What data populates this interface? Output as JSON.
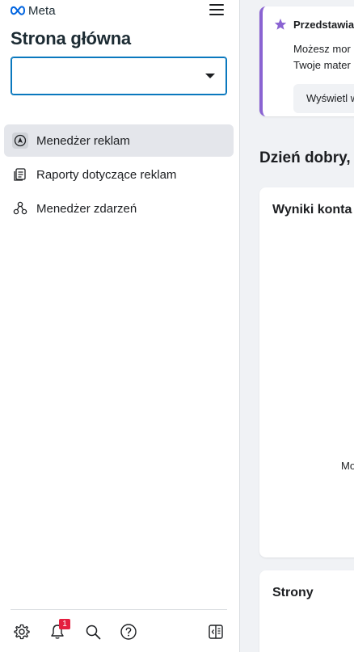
{
  "brand": {
    "name": "Meta"
  },
  "sidebar": {
    "title": "Strona główna",
    "account_select": {
      "value": ""
    },
    "items": [
      {
        "label": "Menedżer reklam",
        "icon": "ads-manager-icon",
        "active": true
      },
      {
        "label": "Raporty dotyczące reklam",
        "icon": "reports-icon",
        "active": false
      },
      {
        "label": "Menedżer zdarzeń",
        "icon": "events-manager-icon",
        "active": false
      }
    ],
    "bottom_icons": [
      "gear-icon",
      "bell-icon",
      "search-icon",
      "help-icon",
      "panel-toggle-icon"
    ],
    "notifications_count": "1"
  },
  "main": {
    "promo": {
      "title": "Przedstawia",
      "line1": "Możesz mor",
      "line2": "Twoje mater",
      "button": "Wyświetl w"
    },
    "greeting": "Dzień dobry,",
    "results_card": {
      "title": "Wyniki konta",
      "center_text": "Mo"
    },
    "pages_card": {
      "title": "Strony"
    }
  },
  "colors": {
    "accent": "#0a78be",
    "promo_border": "#8a63d2",
    "badge": "#e41e3f",
    "background": "#f0f2f5"
  }
}
